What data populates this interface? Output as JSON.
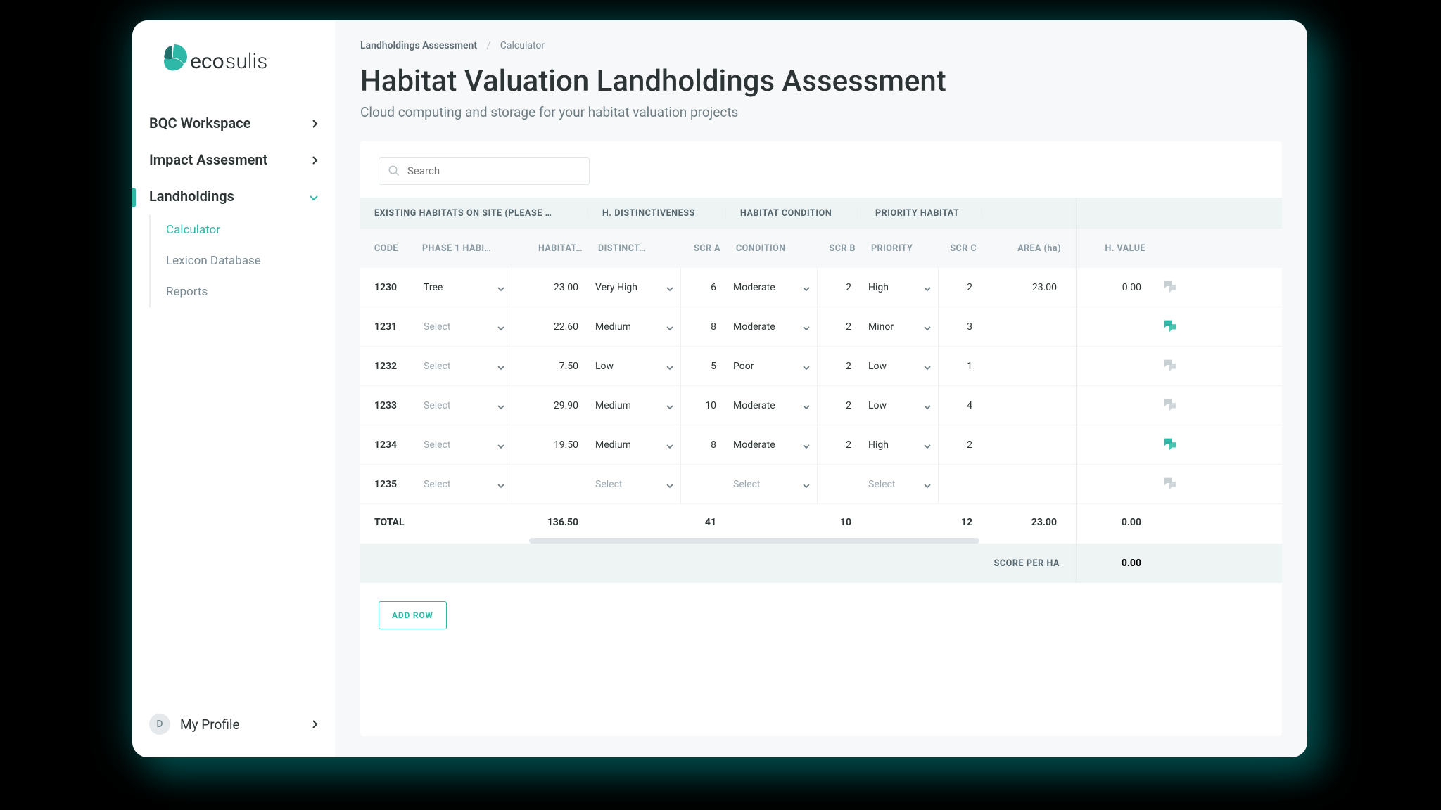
{
  "brand": "ecosulis",
  "sidebar": {
    "items": [
      {
        "label": "BQC Workspace",
        "open": false
      },
      {
        "label": "Impact Assesment",
        "open": false
      },
      {
        "label": "Landholdings",
        "open": true
      }
    ],
    "sub": [
      {
        "label": "Calculator",
        "active": true
      },
      {
        "label": "Lexicon Database",
        "active": false
      },
      {
        "label": "Reports",
        "active": false
      }
    ],
    "profile_initial": "D",
    "profile_label": "My Profile"
  },
  "breadcrumb": {
    "a": "Landholdings Assessment",
    "b": "Calculator"
  },
  "title": "Habitat Valuation Landholdings Assessment",
  "subtitle": "Cloud computing and storage for your habitat valuation projects",
  "search": {
    "placeholder": "Search"
  },
  "thead_top": [
    "EXISTING HABITATS ON SITE (PLEASE …",
    "H. DISTINCTIVENESS",
    "HABITAT CONDITION",
    "PRIORITY HABITAT",
    ""
  ],
  "thead": {
    "code": "CODE",
    "phase1": "PHASE 1 HABI…",
    "habitat": "HABITAT…",
    "distinct": "DISTINCT…",
    "scr_a": "SCR A",
    "condition": "CONDITION",
    "scr_b": "SCR B",
    "priority": "PRIORITY",
    "scr_c": "SCR C",
    "area": "AREA (ha)",
    "hvalue": "H. VALUE"
  },
  "select_placeholder": "Select",
  "rows": [
    {
      "code": "1230",
      "phase1": "Tree",
      "habitat": "23.00",
      "distinct": "Very High",
      "scr_a": "6",
      "condition": "Moderate",
      "scr_b": "2",
      "priority": "High",
      "scr_c": "2",
      "area": "23.00",
      "hvalue": "0.00",
      "chat_active": false
    },
    {
      "code": "1231",
      "phase1": "",
      "habitat": "22.60",
      "distinct": "Medium",
      "scr_a": "8",
      "condition": "Moderate",
      "scr_b": "2",
      "priority": "Minor",
      "scr_c": "3",
      "area": "",
      "hvalue": "",
      "chat_active": true
    },
    {
      "code": "1232",
      "phase1": "",
      "habitat": "7.50",
      "distinct": "Low",
      "scr_a": "5",
      "condition": "Poor",
      "scr_b": "2",
      "priority": "Low",
      "scr_c": "1",
      "area": "",
      "hvalue": "",
      "chat_active": false
    },
    {
      "code": "1233",
      "phase1": "",
      "habitat": "29.90",
      "distinct": "Medium",
      "scr_a": "10",
      "condition": "Moderate",
      "scr_b": "2",
      "priority": "Low",
      "scr_c": "4",
      "area": "",
      "hvalue": "",
      "chat_active": false
    },
    {
      "code": "1234",
      "phase1": "",
      "habitat": "19.50",
      "distinct": "Medium",
      "scr_a": "8",
      "condition": "Moderate",
      "scr_b": "2",
      "priority": "High",
      "scr_c": "2",
      "area": "",
      "hvalue": "",
      "chat_active": true
    },
    {
      "code": "1235",
      "phase1": "",
      "habitat": "",
      "distinct": "",
      "scr_a": "",
      "condition": "",
      "scr_b": "",
      "priority": "",
      "scr_c": "",
      "area": "",
      "hvalue": "",
      "chat_active": false
    }
  ],
  "totals": {
    "label": "TOTAL",
    "habitat": "136.50",
    "scr_a": "41",
    "scr_b": "10",
    "scr_c": "12",
    "area": "23.00",
    "hvalue": "0.00"
  },
  "score_per_ha": {
    "label": "SCORE PER HA",
    "value": "0.00"
  },
  "add_row_label": "ADD ROW",
  "colors": {
    "accent": "#2fb8a7"
  }
}
